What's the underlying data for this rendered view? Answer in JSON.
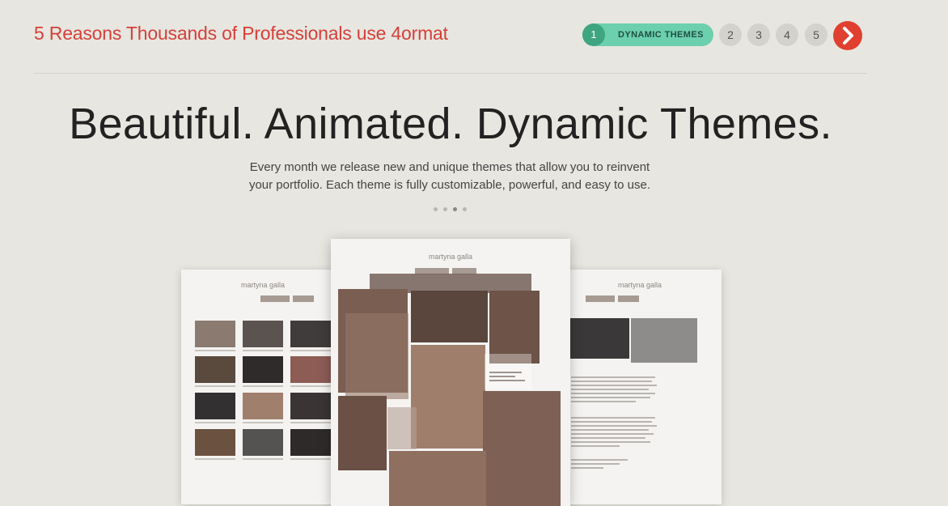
{
  "header": {
    "title": "5 Reasons Thousands of Professionals use 4ormat"
  },
  "steps": {
    "active": {
      "number": "1",
      "label": "DYNAMIC THEMES"
    },
    "items": [
      "2",
      "3",
      "4",
      "5"
    ],
    "next_icon": "chevron-right-icon"
  },
  "hero": {
    "headline": "Beautiful. Animated. Dynamic Themes.",
    "subtext_line1": "Every month we release new and unique themes that allow you to reinvent",
    "subtext_line2": "your portfolio. Each theme is fully customizable, powerful, and easy to use."
  },
  "carousel": {
    "dot_count": 4,
    "active_index": 2
  },
  "mockups": {
    "left": {
      "name": "martyna galla"
    },
    "center": {
      "name": "martyna galla"
    },
    "right": {
      "name": "martyna galla"
    }
  },
  "colors": {
    "accent_red": "#d5403a",
    "step_green": "#6ccfae",
    "step_green_dark": "#3fa580",
    "next_button": "#e0402f",
    "background": "#e8e6e0"
  }
}
